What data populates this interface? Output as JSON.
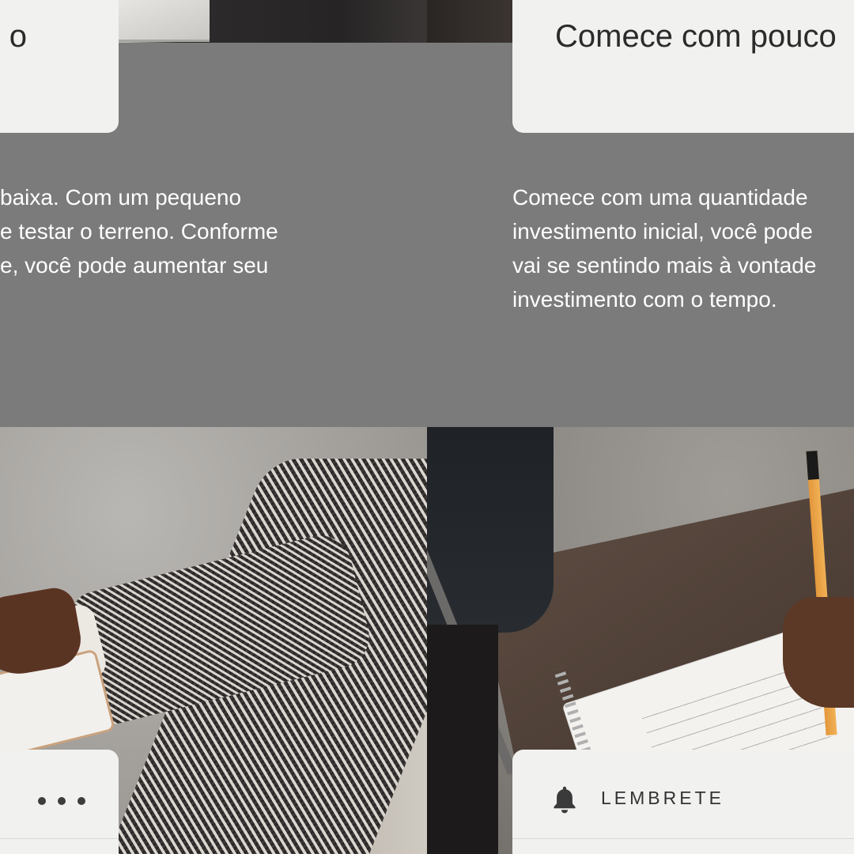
{
  "left_card": {
    "title_fragment": "o",
    "body_lines": [
      " baixa. Com um pequeno",
      "e testar o terreno. Conforme",
      "e, você pode aumentar seu"
    ]
  },
  "right_card": {
    "title": "Comece com pouco",
    "body_lines": [
      "Comece com uma quantidade",
      "investimento inicial, você pode",
      "vai se sentindo mais à vontade",
      "investimento com o tempo."
    ]
  },
  "bottom_left_card": {
    "icon": "more-horizontal-icon"
  },
  "bottom_right_card": {
    "icon": "bell-icon",
    "label": "LEMBRETE"
  },
  "colors": {
    "background_band": "#7b7b7b",
    "card": "#f1f1f0",
    "body_text": "#ffffff",
    "title_text": "#2b2b2b"
  }
}
